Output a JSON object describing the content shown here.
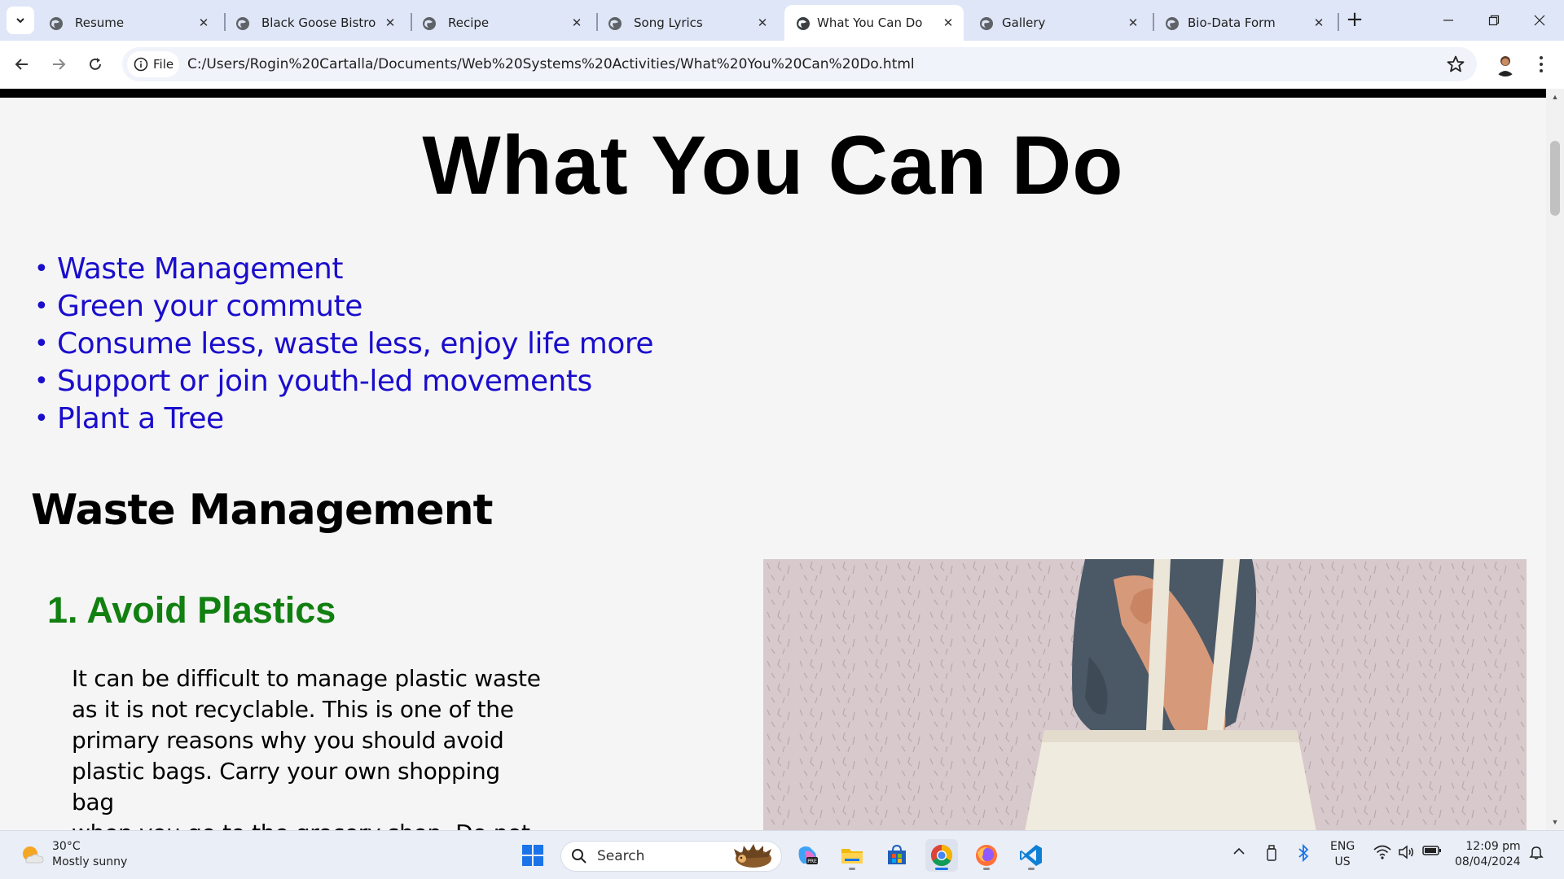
{
  "browser": {
    "tabs": [
      {
        "title": "Resume",
        "active": false
      },
      {
        "title": "Black Goose Bistro",
        "active": false
      },
      {
        "title": "Recipe",
        "active": false
      },
      {
        "title": "Song Lyrics",
        "active": false
      },
      {
        "title": "What You Can Do",
        "active": true
      },
      {
        "title": "Gallery",
        "active": false
      },
      {
        "title": "Bio-Data Form",
        "active": false
      }
    ],
    "site_chip": "File",
    "url": "C:/Users/Rogin%20Cartalla/Documents/Web%20Systems%20Activities/What%20You%20Can%20Do.html",
    "icons": {
      "tab_search": "chevron-down-icon",
      "new_tab": "plus-icon",
      "back": "arrow-left-icon",
      "forward": "arrow-right-icon",
      "reload": "reload-icon",
      "info": "info-icon",
      "bookmark": "star-icon",
      "menu": "kebab-icon"
    },
    "colors": {
      "tabstrip": "#dfe6f7",
      "toolbar": "#ffffff",
      "omnibox": "#f0f3fa"
    }
  },
  "page": {
    "title": "What You Can Do",
    "toc": [
      "Waste Management",
      "Green your commute",
      "Consume less, waste less, enjoy life more",
      "Support or join youth-led movements",
      "Plant a Tree"
    ],
    "section_heading": "Waste Management",
    "sub_heading": "1. Avoid Plastics",
    "body_lines": [
      "It can be difficult to manage plastic waste",
      "as it is not recyclable. This is one of the",
      "primary reasons why you should avoid",
      "plastic bags. Carry your own shopping bag",
      "when you go to the grocery shop. Do not"
    ],
    "colors": {
      "link": "#1a0dcc",
      "sub_heading": "#118011",
      "background": "#f5f5f5"
    }
  },
  "taskbar": {
    "weather_temp": "30°C",
    "weather_desc": "Mostly sunny",
    "search_label": "Search",
    "lang_top": "ENG",
    "lang_bottom": "US",
    "time": "12:09 pm",
    "date": "08/04/2024"
  }
}
